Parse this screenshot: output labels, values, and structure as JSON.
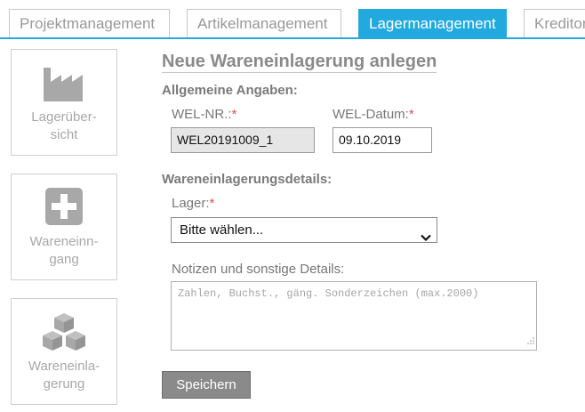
{
  "tabs": [
    {
      "label": "Projektmanagement",
      "active": false
    },
    {
      "label": "Artikelmanagement",
      "active": false
    },
    {
      "label": "Lagermanagement",
      "active": true
    },
    {
      "label": "Kreditoren",
      "active": false
    }
  ],
  "sidebar": {
    "items": [
      {
        "label_line1": "Lagerüber-",
        "label_line2": "sicht",
        "icon": "factory-icon"
      },
      {
        "label_line1": "Wareneinn-",
        "label_line2": "gang",
        "icon": "plus-icon"
      },
      {
        "label_line1": "Wareneinla-",
        "label_line2": "gerung",
        "icon": "boxes-icon"
      }
    ]
  },
  "form": {
    "title": "Neue Wareneinlagerung anlegen",
    "section_general": "Allgemeine Angaben:",
    "wel_nr_label": "WEL-NR.:",
    "wel_nr_value": "WEL20191009_1",
    "wel_date_label": "WEL-Datum:",
    "wel_date_value": "09.10.2019",
    "section_details": "Wareneinlagerungsdetails:",
    "lager_label": "Lager:",
    "lager_selected": "Bitte wählen...",
    "notes_label": "Notizen und sonstige Details:",
    "notes_placeholder": "Zahlen, Buchst., gäng. Sonderzeichen (max.2000)",
    "required_mark": "*",
    "save_label": "Speichern"
  },
  "colors": {
    "accent": "#22a9dd",
    "required": "#d9534f",
    "icon_gray": "#a8a8a8",
    "button_gray": "#8a8a8a"
  }
}
